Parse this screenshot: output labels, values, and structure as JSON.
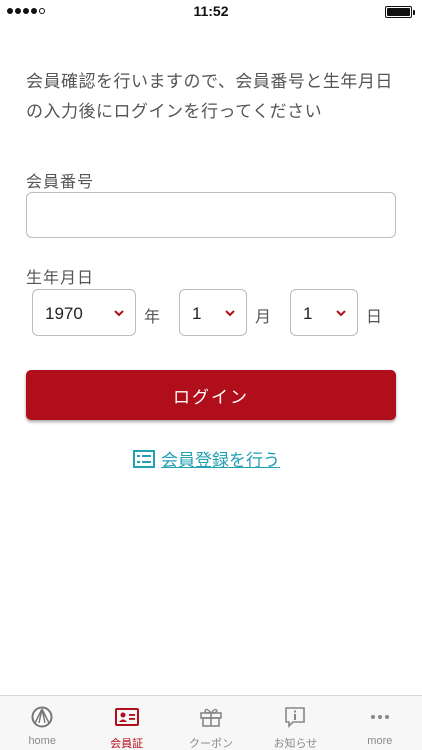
{
  "status_bar": {
    "time": "11:52"
  },
  "intro_text": "会員確認を行いますので、会員番号と生年月日の入力後にログインを行ってください",
  "member_number": {
    "label": "会員番号",
    "value": ""
  },
  "birthdate": {
    "label": "生年月日",
    "year": "1970",
    "year_unit": "年",
    "month": "1",
    "month_unit": "月",
    "day": "1",
    "day_unit": "日"
  },
  "login_button": "ログイン",
  "register_link": "会員登録を行う",
  "colors": {
    "accent": "#b10e1c",
    "link": "#22a0b4"
  },
  "tabs": [
    {
      "label": "home",
      "icon": "home-emblem-icon",
      "active": false
    },
    {
      "label": "会員証",
      "icon": "member-card-icon",
      "active": true
    },
    {
      "label": "クーポン",
      "icon": "gift-icon",
      "active": false
    },
    {
      "label": "お知らせ",
      "icon": "info-bubble-icon",
      "active": false
    },
    {
      "label": "more",
      "icon": "more-dots-icon",
      "active": false
    }
  ]
}
